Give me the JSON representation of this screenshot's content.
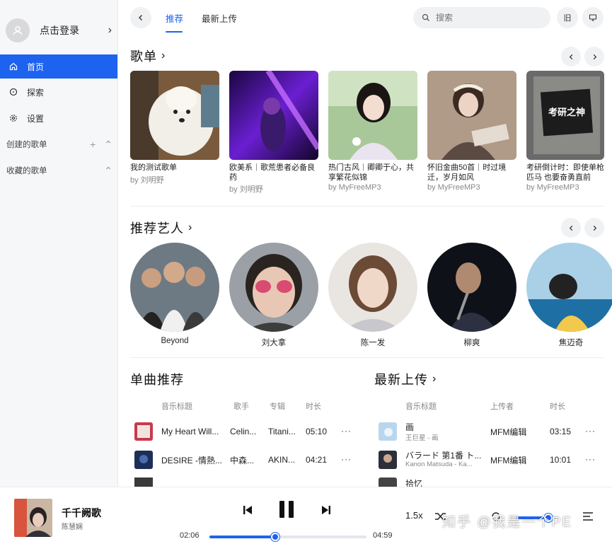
{
  "sidebar": {
    "login": "点击登录",
    "nav": [
      {
        "label": "首页",
        "icon": "home-icon"
      },
      {
        "label": "探索",
        "icon": "compass-icon"
      },
      {
        "label": "设置",
        "icon": "gear-icon"
      }
    ],
    "created_playlists": "创建的歌单",
    "collected_playlists": "收藏的歌单"
  },
  "header": {
    "tabs": [
      "推荐",
      "最新上传"
    ],
    "search_placeholder": "搜索"
  },
  "playlists": {
    "title": "歌单",
    "items": [
      {
        "name": "我的测试歌单",
        "by": "by 刘明野"
      },
      {
        "name": "欧美系｜歌荒患者必备良药",
        "by": "by 刘明野"
      },
      {
        "name": "热门古风｜卿卿于心，共享繁花似锦",
        "by": "by MyFreeMP3"
      },
      {
        "name": "怀旧金曲50首｜时过境迁，岁月如风",
        "by": "by MyFreeMP3"
      },
      {
        "name": "考研倒计时：即使单枪匹马 也要奋勇直前",
        "by": "by MyFreeMP3"
      }
    ],
    "cover5_text": "考研之神"
  },
  "artists": {
    "title": "推荐艺人",
    "items": [
      "Beyond",
      "刘大拿",
      "陈一发",
      "柳爽",
      "焦迈奇"
    ]
  },
  "songs": {
    "title": "单曲推荐",
    "headers": [
      "音乐标题",
      "歌手",
      "专辑",
      "时长"
    ],
    "rows": [
      {
        "title": "My Heart Will...",
        "artist": "Celin...",
        "album": "Titani...",
        "duration": "05:10"
      },
      {
        "title": "DESIRE -情熱...",
        "artist": "中森...",
        "album": "AKIN...",
        "duration": "04:21"
      }
    ]
  },
  "latest": {
    "title": "最新上传",
    "headers": [
      "音乐标题",
      "上传者",
      "时长"
    ],
    "rows": [
      {
        "title": "画",
        "sub": "王巨星 - 画",
        "uploader": "MFM编辑",
        "duration": "03:15"
      },
      {
        "title": "バラード 第1番 ト...",
        "sub": "Kanon Matsuda - Ka...",
        "uploader": "MFM编辑",
        "duration": "10:01"
      },
      {
        "title": "拾忆",
        "sub": "",
        "uploader": "MFM编辑",
        "duration": ""
      }
    ]
  },
  "player": {
    "title": "千千阙歌",
    "artist": "陈慧娴",
    "current_time": "02:06",
    "total_time": "04:59",
    "progress": 0.42,
    "speed": "1.5x",
    "volume": 0.75
  },
  "watermark": "知乎 @我是一个PE",
  "colors": {
    "accent": "#1e63f0",
    "sidebar_bg": "#f6f7f9"
  }
}
